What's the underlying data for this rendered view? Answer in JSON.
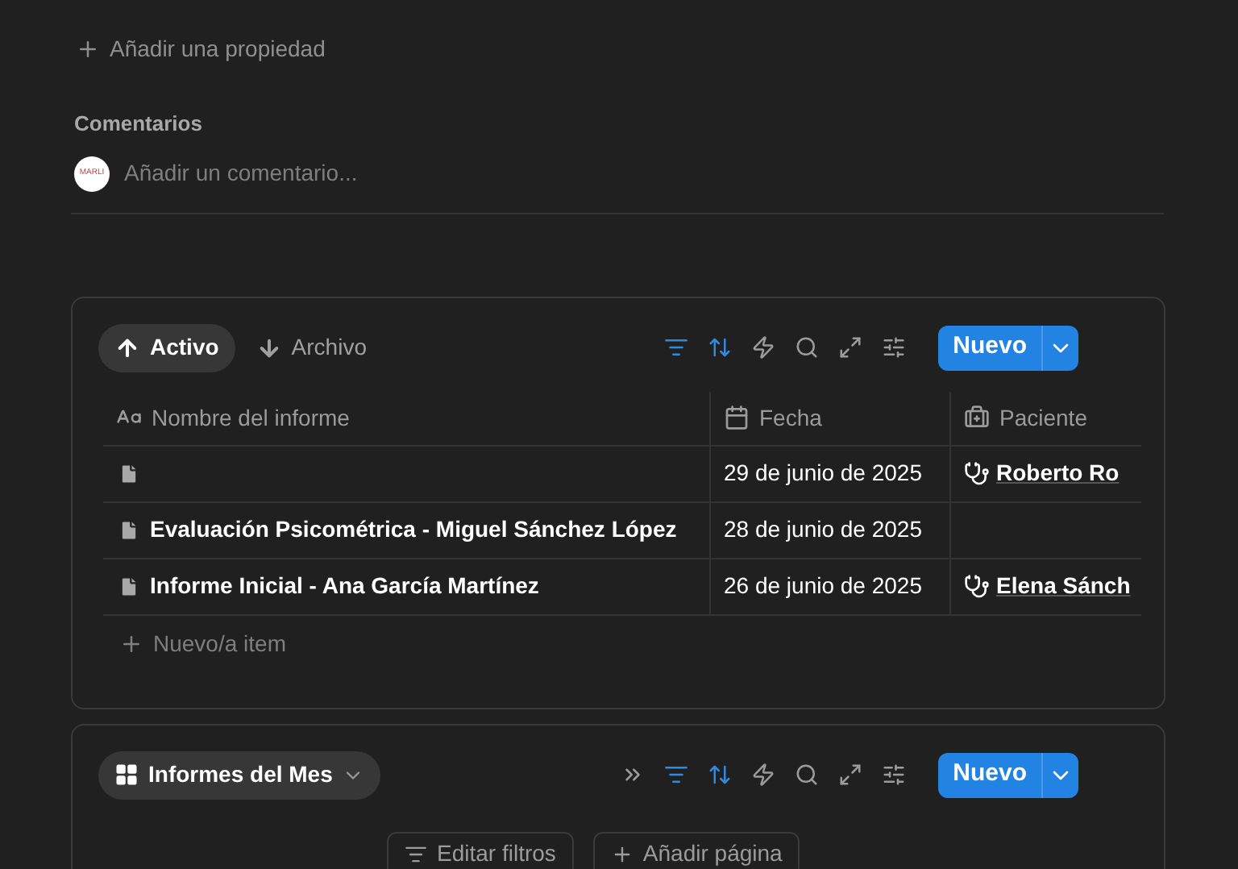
{
  "add_property": {
    "label": "Añadir una propiedad"
  },
  "comments": {
    "title": "Comentarios",
    "avatar_text": "MARLI",
    "placeholder": "Añadir un comentario..."
  },
  "database": {
    "tabs": [
      {
        "label": "Activo",
        "selected": true
      },
      {
        "label": "Archivo",
        "selected": false
      }
    ],
    "toolbar": [
      {
        "kind": "filter",
        "active": true
      },
      {
        "kind": "sort",
        "active": true
      },
      {
        "kind": "automation",
        "active": false
      },
      {
        "kind": "search",
        "active": false
      },
      {
        "kind": "expand",
        "active": false
      },
      {
        "kind": "settings",
        "active": false
      }
    ],
    "new_button": "Nuevo",
    "columns": [
      {
        "label": "Nombre del informe"
      },
      {
        "label": "Fecha"
      },
      {
        "label": "Paciente"
      }
    ],
    "rows": [
      {
        "name": "",
        "date": "29 de junio de 2025",
        "patient": "Roberto Ro"
      },
      {
        "name": "Evaluación Psicométrica - Miguel Sánchez López",
        "date": "28 de junio de 2025",
        "patient": ""
      },
      {
        "name": "Informe Inicial - Ana García Martínez",
        "date": "26 de junio de 2025",
        "patient": "Elena Sánch"
      }
    ],
    "new_item": "Nuevo/a item"
  },
  "database_2": {
    "view": "Informes del Mes",
    "toolbar": [
      {
        "kind": "more",
        "active": false
      },
      {
        "kind": "filter",
        "active": true
      },
      {
        "kind": "sort",
        "active": true
      },
      {
        "kind": "automation",
        "active": false
      },
      {
        "kind": "search",
        "active": false
      },
      {
        "kind": "expand",
        "active": false
      },
      {
        "kind": "settings",
        "active": false
      }
    ],
    "new_button": "Nuevo",
    "actions": [
      {
        "label": "Editar filtros"
      },
      {
        "label": "Añadir página"
      }
    ]
  }
}
